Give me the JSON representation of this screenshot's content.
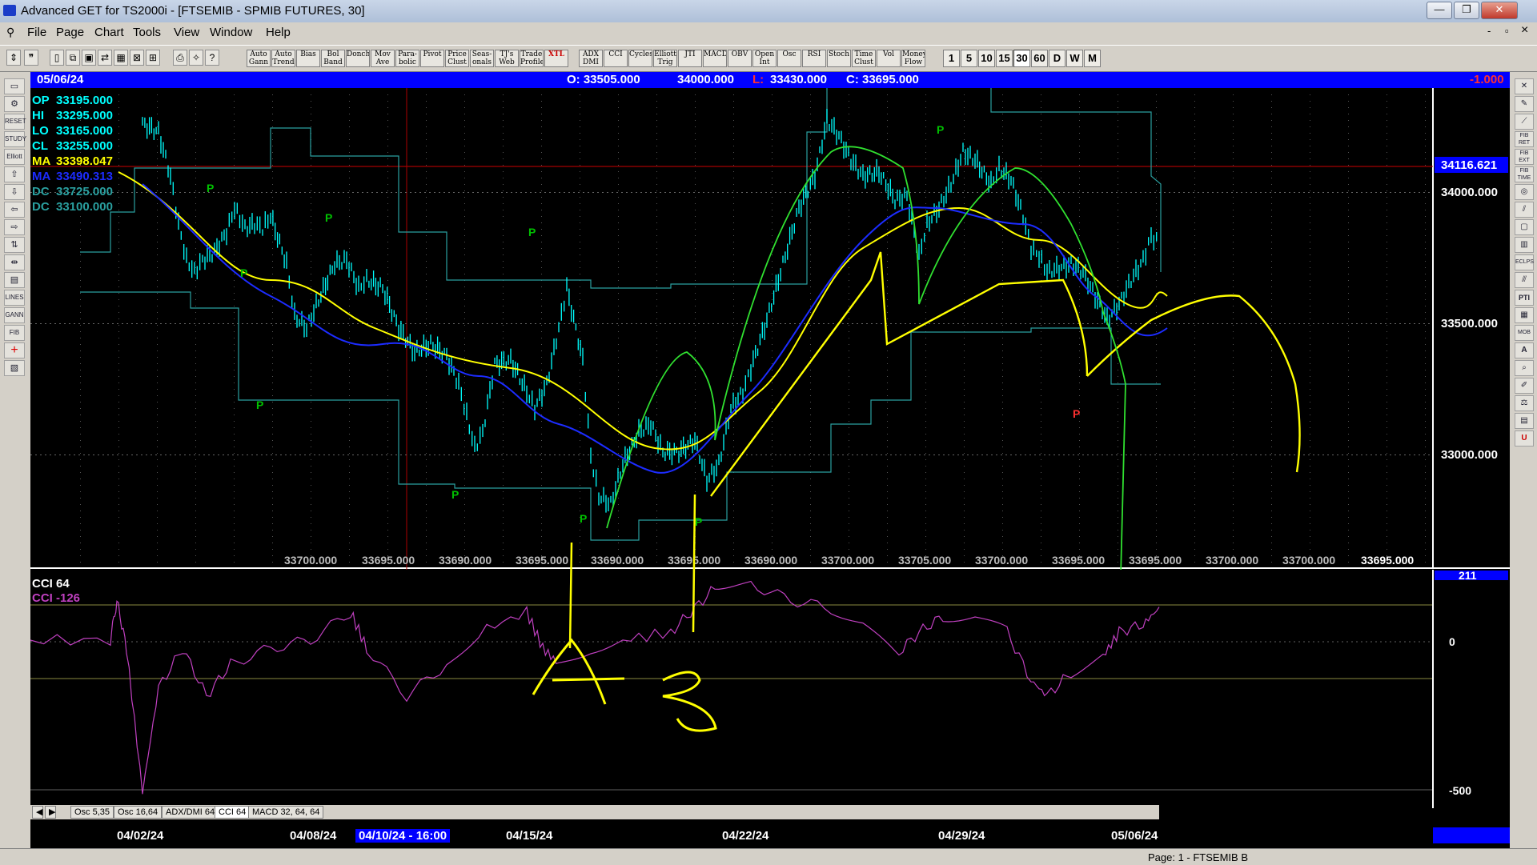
{
  "window": {
    "title": "Advanced GET for TS2000i - [FTSEMIB - SPMIB FUTURES, 30]",
    "min": "—",
    "max": "❐",
    "close": "✕",
    "mdi_min": "-",
    "mdi_restore": "▫",
    "mdi_close": "×"
  },
  "menu": [
    "File",
    "Page",
    "Chart",
    "Tools",
    "View",
    "Window",
    "Help"
  ],
  "toolbar": {
    "study_buttons": [
      "Auto Gann",
      "Auto Trend",
      "Bias",
      "Bol Band",
      "Donch",
      "Mov Ave",
      "Para-bolic",
      "Pivot",
      "Price Clust",
      "Seas-onals",
      "TJ's Web",
      "Trade Profile",
      "XTL",
      "ADX DMI",
      "CCI",
      "Cycles",
      "Elliott Trig",
      "JTI",
      "MACD",
      "OBV",
      "Open Int",
      "Osc",
      "RSI",
      "Stoch",
      "Time Clust",
      "Vol",
      "Money Flow"
    ],
    "timeframes": [
      "1",
      "5",
      "10",
      "15",
      "30",
      "60",
      "D",
      "W",
      "M"
    ],
    "active_timeframe": "30"
  },
  "infobar": {
    "date": "05/06/24",
    "open": "O: 33505.000",
    "high": "34000.000",
    "low_label": "L:",
    "low": "33430.000",
    "close": "C: 33695.000",
    "change": "-1.000"
  },
  "legend": [
    {
      "label": "OP",
      "value": "33195.000",
      "color": "#00ffff"
    },
    {
      "label": "HI",
      "value": "33295.000",
      "color": "#00ffff"
    },
    {
      "label": "LO",
      "value": "33165.000",
      "color": "#00ffff"
    },
    {
      "label": "CL",
      "value": "33255.000",
      "color": "#00ffff"
    },
    {
      "label": "MA",
      "value": "33398.047",
      "color": "#ffff00"
    },
    {
      "label": "MA",
      "value": "33490.313",
      "color": "#1c2cff"
    },
    {
      "label": "DC",
      "value": "33725.000",
      "color": "#2aa0a0"
    },
    {
      "label": "DC",
      "value": "33100.000",
      "color": "#2aa0a0"
    }
  ],
  "price_axis": {
    "labels": [
      "34000.000",
      "33500.000",
      "33000.000"
    ],
    "current": "34116.621"
  },
  "pivot_label": "P",
  "bottom_values": [
    "33700.000",
    "33695.000",
    "33690.000",
    "33695.000",
    "33690.000",
    "33695.000",
    "33690.000",
    "33700.000",
    "33705.000",
    "33700.000",
    "33695.000",
    "33695.000",
    "33700.000",
    "33700.000",
    "33695.000"
  ],
  "cci": {
    "title": "CCI 64",
    "value_label": "CCI  -126",
    "axis": [
      "211",
      "0",
      "-500"
    ]
  },
  "annotations": {
    "a": "A",
    "b": "B"
  },
  "osc_tabs": [
    "Osc 5,35",
    "Osc 16,64",
    "ADX/DMI 64",
    "CCI 64",
    "MACD 32, 64, 64"
  ],
  "osc_active": "CCI 64",
  "dates": [
    "04/02/24",
    "04/08/24",
    "04/10/24 - 16:00",
    "04/15/24",
    "04/22/24",
    "04/29/24",
    "05/06/24"
  ],
  "status": "Page: 1 - FTSEMIB B",
  "colors": {
    "price_bars": "#00ffff",
    "ma_fast": "#1c2cff",
    "ma_slow": "#ffff00",
    "donchian": "#2aa0a0",
    "cci": "#c040c0",
    "pivot": "#00c000",
    "hand_yellow": "#ffff00",
    "hand_green": "#30e030"
  }
}
